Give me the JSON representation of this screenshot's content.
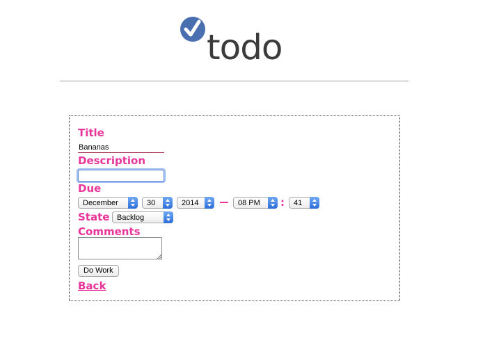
{
  "logo": {
    "text": "todo",
    "icon": "checkmark-circle-icon"
  },
  "form": {
    "title_label": "Title",
    "title_value": "Bananas",
    "description_label": "Description",
    "description_value": "",
    "due_label": "Due",
    "due": {
      "month": "December",
      "day": "30",
      "year": "2014",
      "hour": "08 PM",
      "minute": "41"
    },
    "state_label": "State",
    "state_value": "Backlog",
    "comments_label": "Comments",
    "comments_value": "",
    "submit_label": "Do Work",
    "back_label": "Back"
  },
  "colors": {
    "accent": "#e8359a",
    "logo_blue": "#4a6fb0"
  }
}
